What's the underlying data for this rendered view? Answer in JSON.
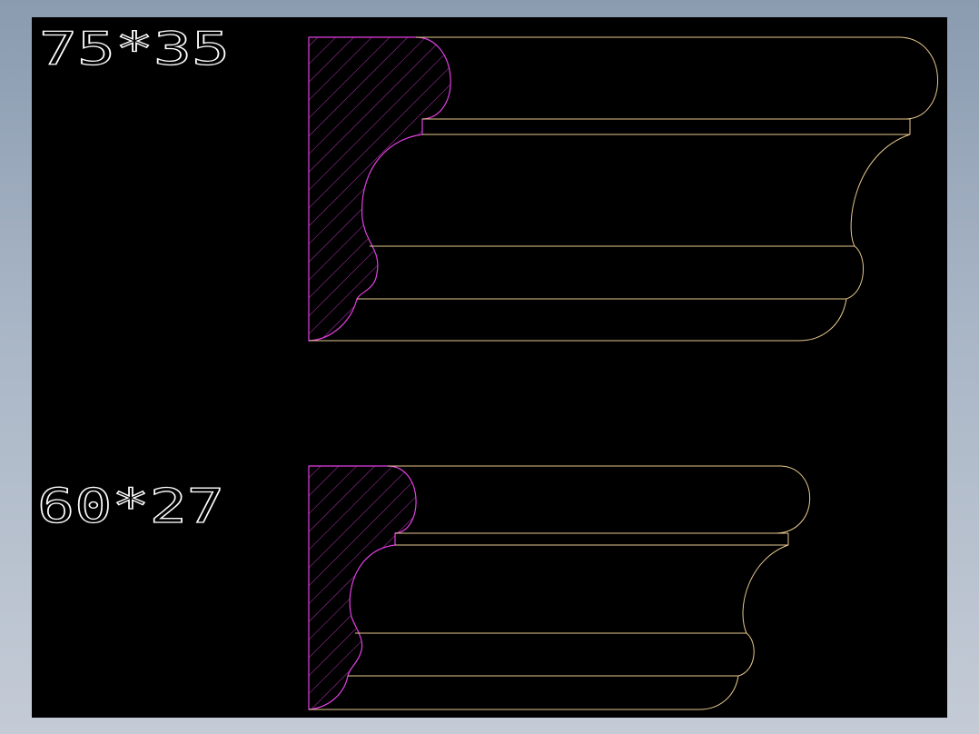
{
  "drawing": {
    "background": "#000000",
    "profile_color": "#e7c98e",
    "section_color": "#e23fe2",
    "label_color": "#ffffff",
    "profiles": [
      {
        "label": "75*35"
      },
      {
        "label": "60*27"
      }
    ]
  }
}
